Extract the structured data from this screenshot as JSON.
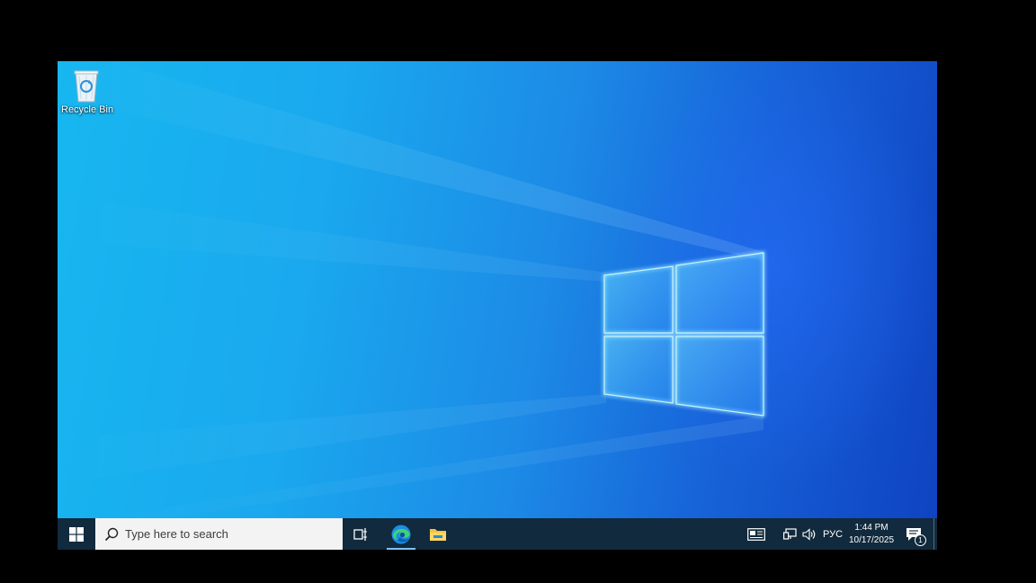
{
  "desktop": {
    "icons": [
      {
        "label": "Recycle Bin",
        "icon": "recycle-bin-icon"
      }
    ],
    "colors": {
      "wallpaper_light": "#17b7f0",
      "wallpaper_dark": "#0f43c2",
      "logo_glow": "#5fd0ff"
    }
  },
  "taskbar": {
    "background": "#112a3d",
    "start_icon": "windows-logo-icon",
    "search": {
      "placeholder": "Type here to search",
      "icon": "search-icon"
    },
    "pinned": [
      {
        "name": "Task View",
        "icon": "task-view-icon"
      },
      {
        "name": "Microsoft Edge",
        "icon": "edge-icon",
        "active": true
      },
      {
        "name": "File Explorer",
        "icon": "file-explorer-icon"
      }
    ],
    "tray": {
      "news_icon": "news-widget-icon",
      "network_icon": "network-icon",
      "volume_icon": "volume-icon",
      "language": "РУС",
      "time": "1:44 PM",
      "date": "10/17/2025",
      "notification_icon": "action-center-icon",
      "notification_count": "1"
    }
  }
}
